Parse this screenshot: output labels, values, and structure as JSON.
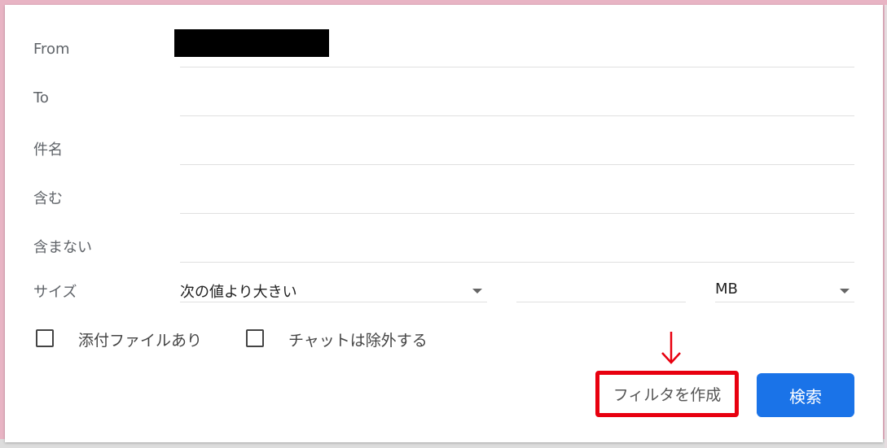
{
  "dialog": {
    "fields": [
      {
        "label": "From",
        "value": "",
        "redacted": true
      },
      {
        "label": "To",
        "value": ""
      },
      {
        "label": "件名",
        "value": ""
      },
      {
        "label": "含む",
        "value": ""
      },
      {
        "label": "含まない",
        "value": ""
      }
    ],
    "size": {
      "label": "サイズ",
      "comparison": "次の値より大きい",
      "value": "",
      "unit": "MB"
    },
    "checkboxes": [
      {
        "label": "添付ファイルあり",
        "checked": false
      },
      {
        "label": "チャットは除外する",
        "checked": false
      }
    ],
    "actions": {
      "create_filter": "フィルタを作成",
      "search": "検索"
    },
    "annotation": {
      "arrow_color": "#e8000f",
      "highlight_color": "#e8000f"
    },
    "colors": {
      "primary": "#1a73e8",
      "background": "#e8b4c4"
    }
  }
}
